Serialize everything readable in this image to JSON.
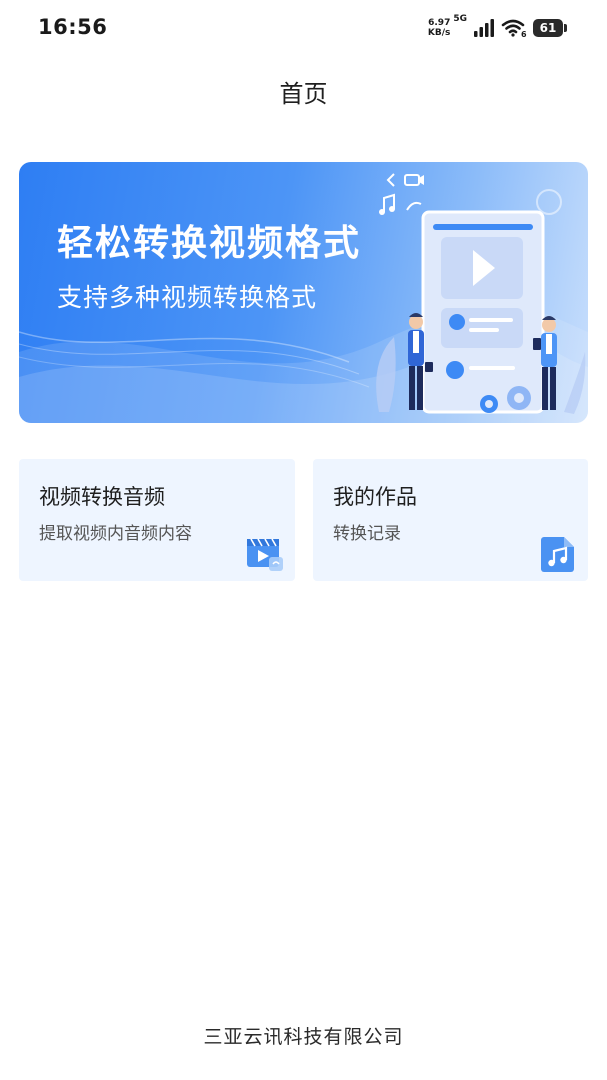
{
  "status_bar": {
    "time": "16:56",
    "net_speed_value": "6.97",
    "net_speed_unit": "KB/s",
    "net_type": "5G",
    "wifi_badge": "6",
    "battery": "61"
  },
  "header": {
    "title": "首页"
  },
  "banner": {
    "title": "轻松转换视频格式",
    "subtitle": "支持多种视频转换格式"
  },
  "cards": [
    {
      "title": "视频转换音频",
      "subtitle": "提取视频内音频内容",
      "icon": "video-clapper-icon"
    },
    {
      "title": "我的作品",
      "subtitle": "转换记录",
      "icon": "music-note-icon"
    }
  ],
  "footer": {
    "company": "三亚云讯科技有限公司"
  },
  "colors": {
    "accent": "#3d8af5",
    "card_bg": "#eef5ff",
    "icon_blue": "#4a92f2"
  }
}
